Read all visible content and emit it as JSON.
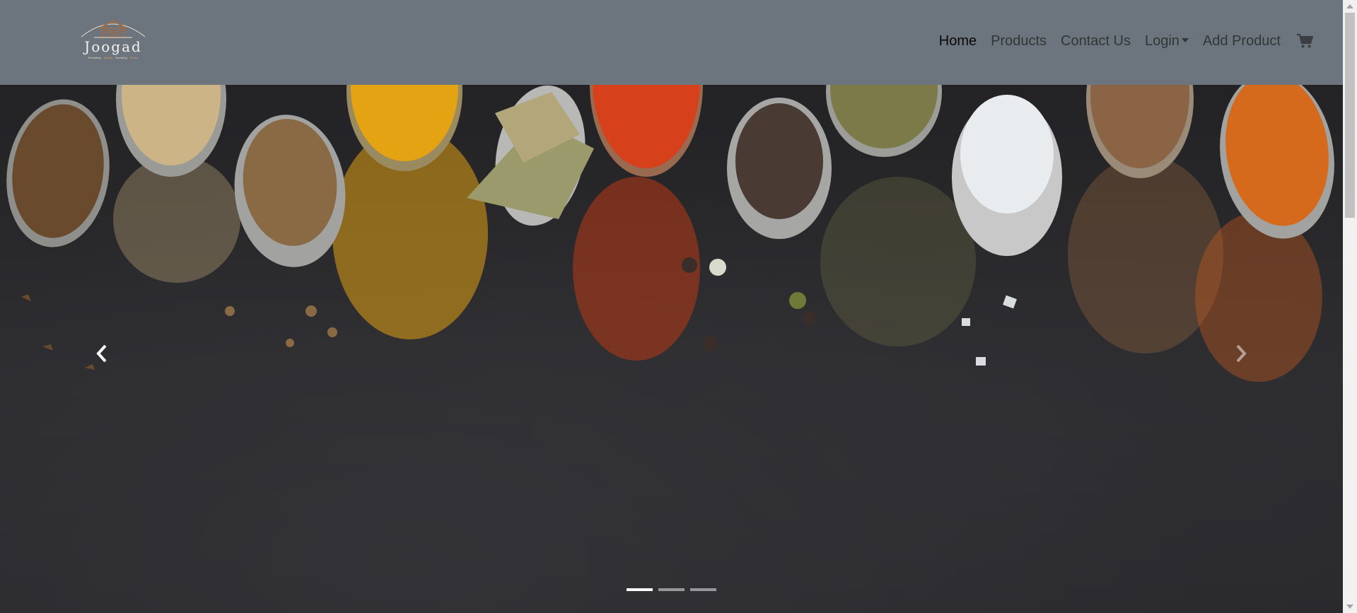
{
  "brand": {
    "name": "Joogad",
    "tagline": [
      "Recruiting",
      "Quality",
      "Nurturing",
      "Future"
    ]
  },
  "nav": {
    "items": [
      {
        "label": "Home",
        "active": true
      },
      {
        "label": "Products",
        "active": false
      },
      {
        "label": "Contact Us",
        "active": false
      },
      {
        "label": "Login",
        "active": false,
        "dropdown": true
      },
      {
        "label": "Add Product",
        "active": false
      }
    ],
    "cart_icon": "shopping-cart-icon"
  },
  "carousel": {
    "slide_count": 3,
    "active_slide": 1,
    "prev_icon": "chevron-left-icon",
    "next_icon": "chevron-right-icon",
    "image_subject": "spices-on-spoons"
  },
  "colors": {
    "navbar_bg": "#6c757d",
    "nav_active": "#111111",
    "nav_inactive": "#3b3f43",
    "carousel_bg": "#29292c"
  }
}
